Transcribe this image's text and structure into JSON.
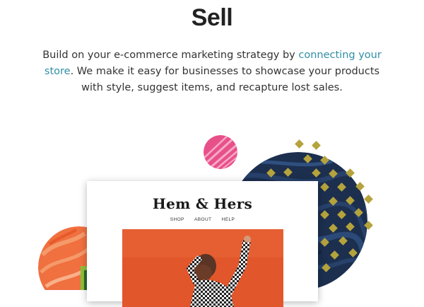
{
  "section": {
    "title": "Sell",
    "intro_before": "Build on your e-commerce marketing strategy by ",
    "intro_link": "connecting your store",
    "intro_after": ". We make it easy for businesses to showcase your products with style, suggest items, and recapture lost sales."
  },
  "preview": {
    "brand": "Hem & Hers",
    "nav": [
      "SHOP",
      "ABOUT",
      "HELP"
    ]
  },
  "colors": {
    "link": "#2f8fa6",
    "pink_circle": "#e8508a",
    "navy_circle": "#1c2f4f",
    "olive_diamonds": "#b5a33c",
    "orange_circle": "#f07040",
    "hero_bg": "#e2562b"
  }
}
